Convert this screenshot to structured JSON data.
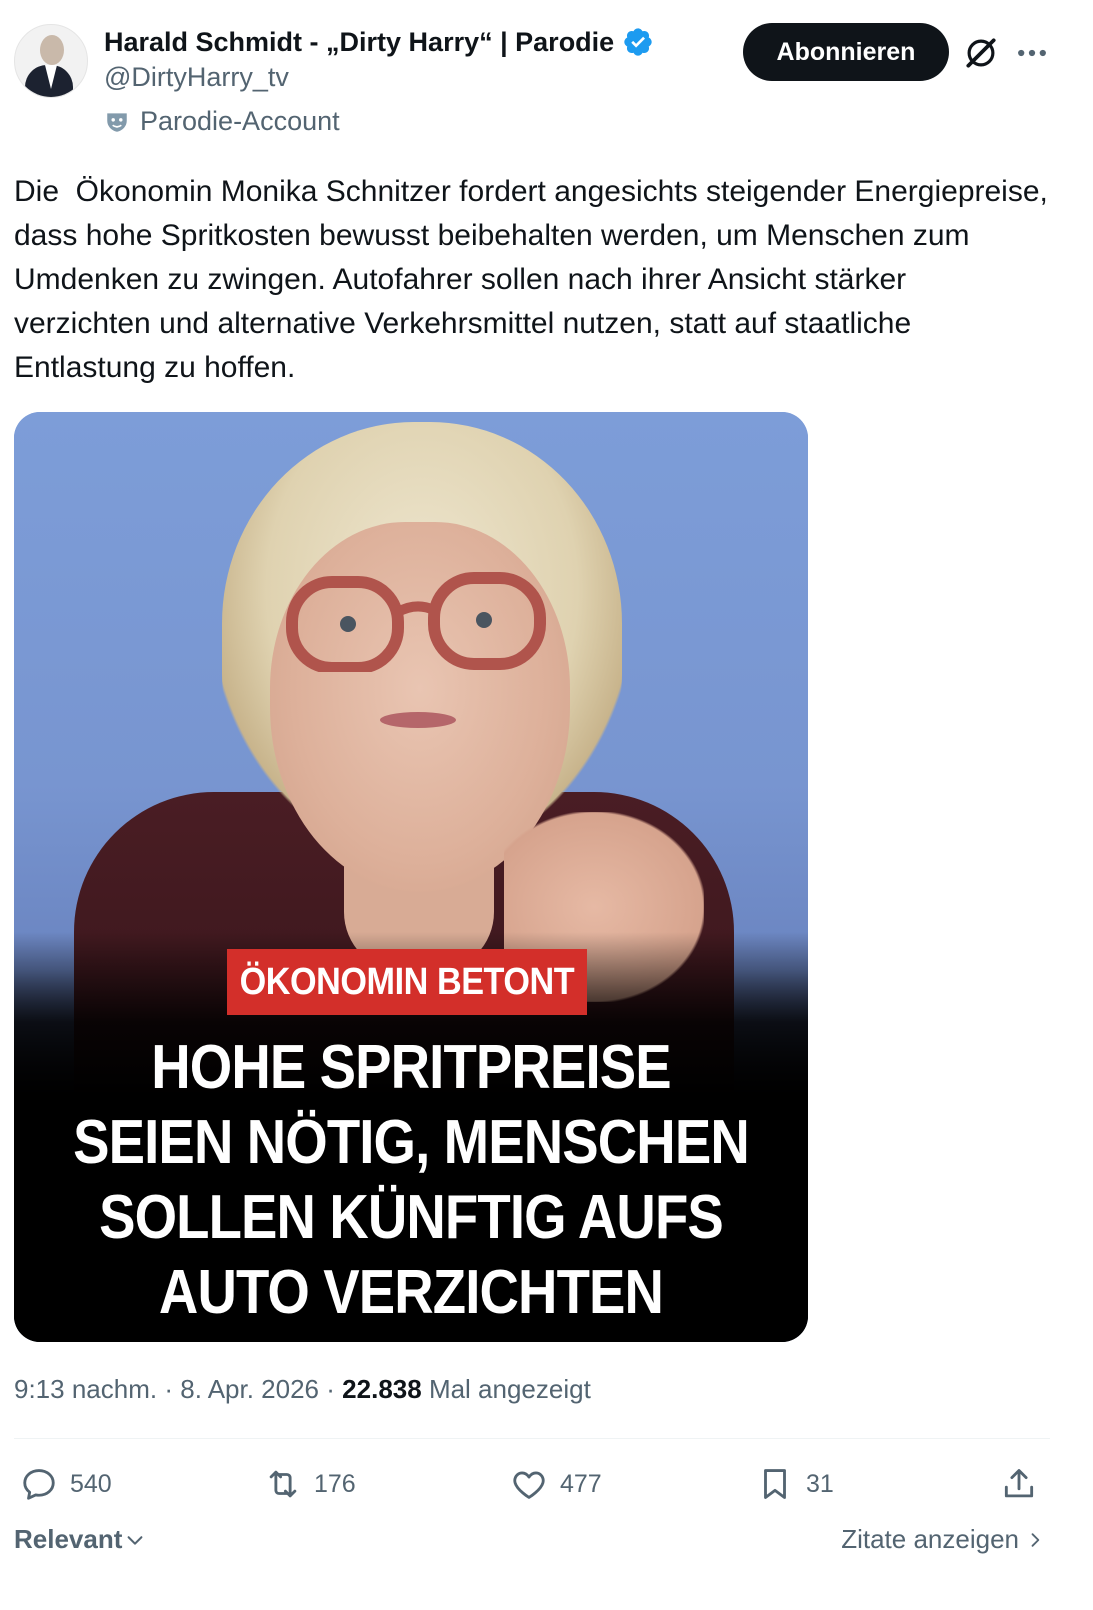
{
  "author": {
    "display_name": "Harald Schmidt - „Dirty Harry“ | Parodie",
    "handle": "@DirtyHarry_tv",
    "label": "Parodie-Account"
  },
  "buttons": {
    "follow": "Abonnieren"
  },
  "tweet": {
    "text": "Die  Ökonomin Monika Schnitzer fordert angesichts steigender Energiepreise,  dass hohe Spritkosten bewusst beibehalten werden, um Menschen zum  Umdenken zu zwingen. Autofahrer sollen nach ihrer Ansicht stärker  verzichten und alternative Verkehrsmittel nutzen, statt auf staatliche  Entlastung zu hoffen."
  },
  "media": {
    "kicker": "ÖKONOMIN BETONT",
    "headline_lines": [
      "HOHE SPRITPREISE",
      "SEIEN NÖTIG, MENSCHEN",
      "SOLLEN KÜNFTIG AUFS",
      "AUTO VERZICHTEN"
    ]
  },
  "meta": {
    "time": "9:13 nachm.",
    "separator": "·",
    "date": "8. Apr. 2026",
    "views": "22.838",
    "views_label": "Mal angezeigt"
  },
  "actions": {
    "replies": "540",
    "reposts": "176",
    "likes": "477",
    "bookmarks": "31"
  },
  "footer": {
    "sort": "Relevant",
    "quotes": "Zitate anzeigen"
  },
  "colors": {
    "verified": "#1d9bf0",
    "text_primary": "#0f1419",
    "text_secondary": "#536471",
    "kicker_bg": "#d32f2a"
  },
  "icons": [
    "verified-badge-icon",
    "parody-mask-icon",
    "grok-icon",
    "more-icon",
    "reply-icon",
    "repost-icon",
    "like-icon",
    "bookmark-icon",
    "share-icon",
    "chevron-down-icon",
    "chevron-right-icon"
  ]
}
